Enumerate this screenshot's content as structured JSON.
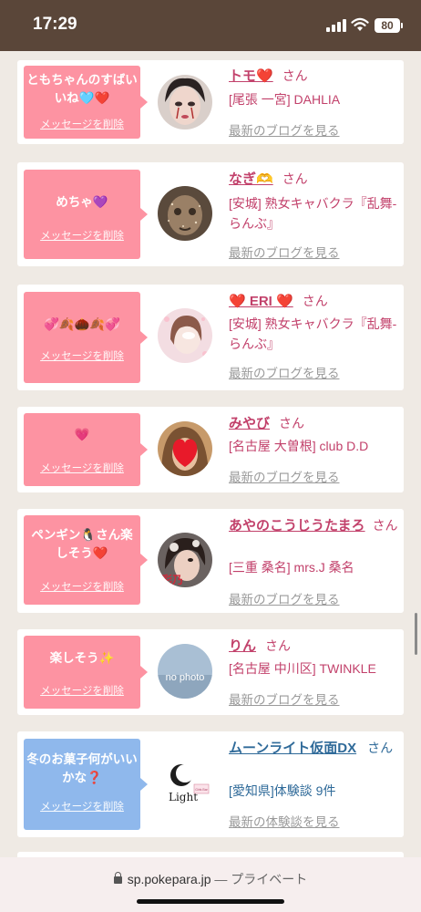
{
  "status_bar": {
    "time": "17:29",
    "battery": "80"
  },
  "cards": [
    {
      "bubble_color": "pink",
      "message": "ともちゃんのすばいいね🩵❤️",
      "delete_label": "メッセージを削除",
      "name": "トモ❤️",
      "honorific": "さん",
      "shop": "[尾張 一宮] DAHLIA",
      "blog_link": "最新のブログを見る",
      "link_color": "pink"
    },
    {
      "bubble_color": "pink",
      "message": "めちゃ💜",
      "delete_label": "メッセージを削除",
      "name": "なぎ🫶",
      "honorific": "さん",
      "shop": "[安城] 熟女キャバクラ『乱舞-らんぶ』",
      "blog_link": "最新のブログを見る",
      "link_color": "pink"
    },
    {
      "bubble_color": "pink",
      "message": "💞🍂🌰🍂💞",
      "delete_label": "メッセージを削除",
      "name": "❤️ ERI ❤️",
      "honorific": "さん",
      "shop": "[安城] 熟女キャバクラ『乱舞-らんぶ』",
      "blog_link": "最新のブログを見る",
      "link_color": "pink"
    },
    {
      "bubble_color": "pink",
      "message": "💗",
      "delete_label": "メッセージを削除",
      "name": "みやび",
      "honorific": "さん",
      "shop": "[名古屋 大曽根] club D.D",
      "blog_link": "最新のブログを見る",
      "link_color": "pink"
    },
    {
      "bubble_color": "pink",
      "message": "ペンギン🐧さん楽しそう❤️",
      "delete_label": "メッセージを削除",
      "name": "あやのこうじうたまろ",
      "honorific": "さん",
      "shop": "[三重 桑名] mrs.J 桑名",
      "blog_link": "最新のブログを見る",
      "link_color": "pink",
      "avatar_text": "彩乃"
    },
    {
      "bubble_color": "pink",
      "message": "楽しそう✨",
      "delete_label": "メッセージを削除",
      "name": "りん",
      "honorific": "さん",
      "shop": "[名古屋 中川区] TWINKLE",
      "blog_link": "最新のブログを見る",
      "link_color": "pink",
      "avatar_text": "no photo"
    },
    {
      "bubble_color": "blue",
      "message": "冬のお菓子何がいいかな❓",
      "delete_label": "メッセージを削除",
      "name": "ムーンライト仮面DX",
      "honorific": "さん",
      "shop": "[愛知県]体験談 9件",
      "blog_link": "最新の体験談を見る",
      "link_color": "blue",
      "avatar_text": "Light",
      "avatar_tag": "Girls Bar"
    }
  ],
  "url_bar": {
    "domain": "sp.pokepara.jp",
    "privacy": "— プライベート"
  },
  "colors": {
    "pink_bubble": "#fd93a2",
    "blue_bubble": "#8fb8ec",
    "name_pink": "#c2416b",
    "name_blue": "#2f6a99",
    "status_bar": "#5a4639"
  }
}
